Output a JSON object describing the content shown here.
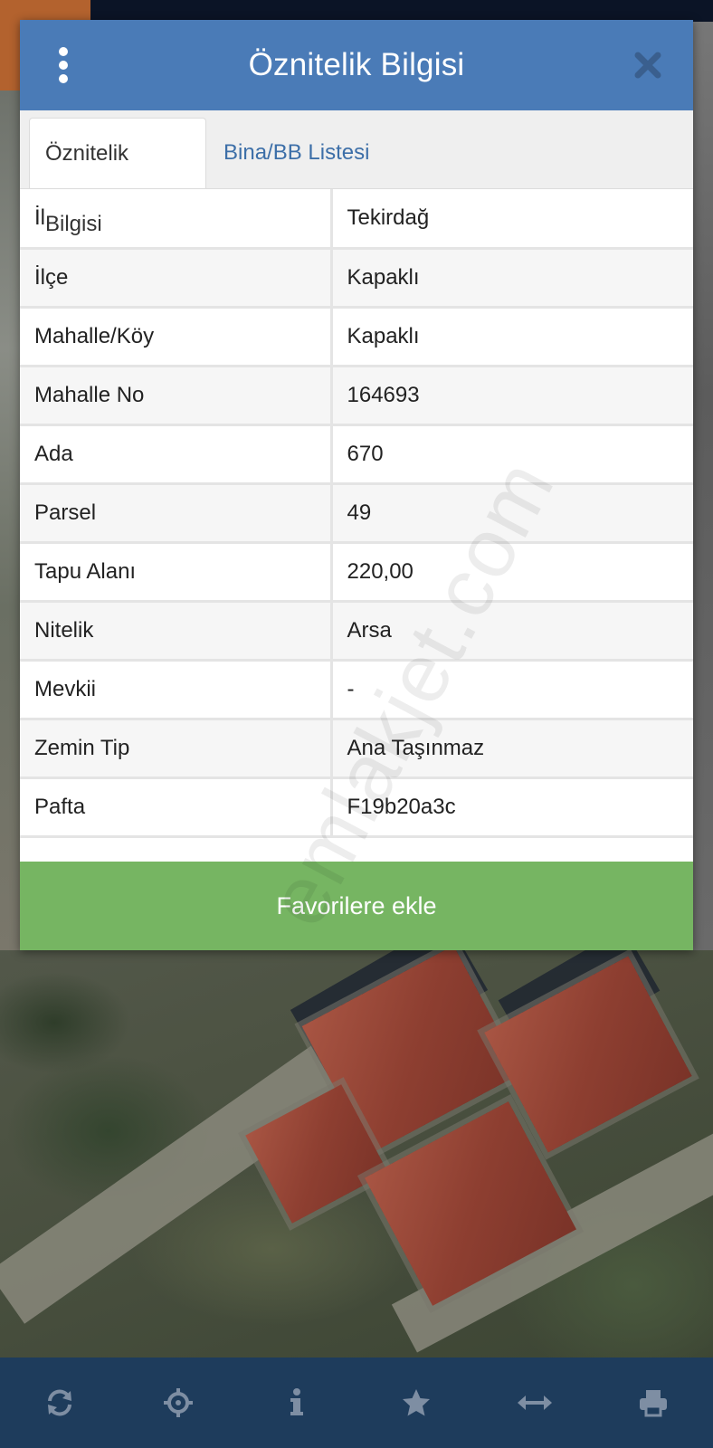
{
  "dialog": {
    "title": "Öznitelik Bilgisi",
    "icons": {
      "menu": "vertical-dots-icon",
      "close": "close-icon"
    }
  },
  "tabs": [
    {
      "label": "Öznitelik Bilgisi",
      "active": true
    },
    {
      "label": "Bina/BB Listesi",
      "active": false
    }
  ],
  "attributes": [
    {
      "key": "İl",
      "value": "Tekirdağ"
    },
    {
      "key": "İlçe",
      "value": "Kapaklı"
    },
    {
      "key": "Mahalle/Köy",
      "value": "Kapaklı"
    },
    {
      "key": "Mahalle No",
      "value": "164693"
    },
    {
      "key": "Ada",
      "value": "670"
    },
    {
      "key": "Parsel",
      "value": "49"
    },
    {
      "key": "Tapu Alanı",
      "value": "220,00"
    },
    {
      "key": "Nitelik",
      "value": "Arsa"
    },
    {
      "key": "Mevkii",
      "value": "-"
    },
    {
      "key": "Zemin Tip",
      "value": "Ana Taşınmaz"
    },
    {
      "key": "Pafta",
      "value": "F19b20a3c"
    }
  ],
  "favorite_button": "Favorilere ekle",
  "watermark": "emlakjet.com",
  "toolbar": {
    "icons": [
      "refresh-icon",
      "locate-icon",
      "info-icon",
      "star-icon",
      "measure-icon",
      "print-icon"
    ]
  },
  "colors": {
    "header": "#4a7bb7",
    "favorite": "#76b562",
    "toolbar": "#1e3c5c",
    "tab_link": "#3d6fa8"
  }
}
